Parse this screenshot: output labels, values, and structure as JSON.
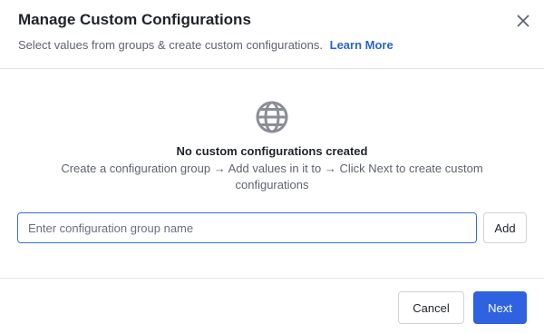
{
  "dialog": {
    "title": "Manage Custom Configurations",
    "subtitle": "Select values from groups & create custom configurations.",
    "learn_more_label": "Learn More",
    "close_icon": "close-icon"
  },
  "empty_state": {
    "icon": "globe-icon",
    "title": "No custom configurations created",
    "description": "Create a configuration group → Add values in it to → Click Next to create custom configurations"
  },
  "group_input": {
    "placeholder": "Enter configuration group name",
    "value": "",
    "add_label": "Add"
  },
  "footer": {
    "cancel_label": "Cancel",
    "next_label": "Next"
  },
  "colors": {
    "accent": "#2e62e0",
    "link": "#2a63d4",
    "input_focus_border": "#3a6fd6",
    "divider": "#e3e4e8"
  }
}
